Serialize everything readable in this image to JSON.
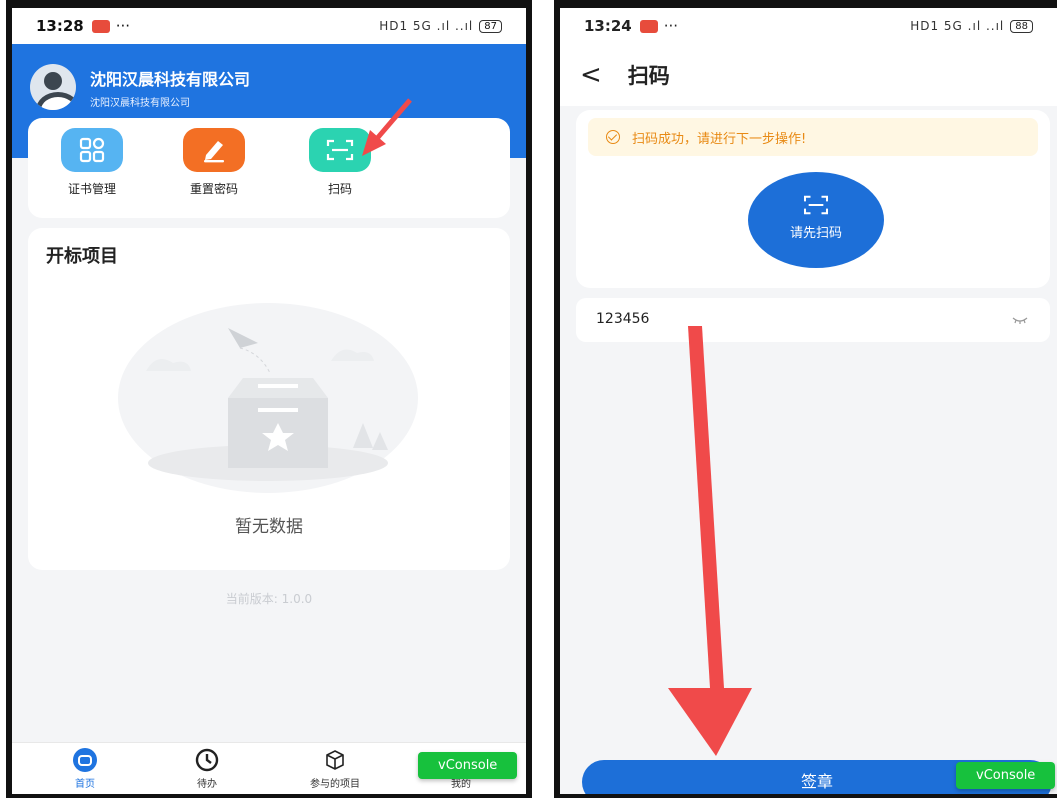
{
  "left_phone": {
    "status": {
      "time": "13:28",
      "indicators": "HD1 5G .ıl ..ıl",
      "battery": "87"
    },
    "company": {
      "name": "沈阳汉晨科技有限公司",
      "sub": "沈阳汉晨科技有限公司"
    },
    "quick_actions": [
      {
        "label": "证书管理",
        "icon": "grid-icon"
      },
      {
        "label": "重置密码",
        "icon": "edit-icon"
      },
      {
        "label": "扫码",
        "icon": "scan-icon"
      }
    ],
    "projects": {
      "title": "开标项目",
      "empty_text": "暂无数据"
    },
    "version": "当前版本: 1.0.0",
    "tabs": [
      {
        "label": "首页",
        "icon": "home-icon",
        "active": true
      },
      {
        "label": "待办",
        "icon": "clock-icon"
      },
      {
        "label": "参与的项目",
        "icon": "cube-icon"
      },
      {
        "label": "我的",
        "icon": "user-icon"
      }
    ],
    "vconsole": "vConsole"
  },
  "right_phone": {
    "status": {
      "time": "13:24",
      "indicators": "HD1 5G .ıl ..ıl",
      "battery": "88"
    },
    "nav": {
      "back": "<",
      "title": "扫码"
    },
    "banner": "扫码成功，请进行下一步操作!",
    "scan_button": "请先扫码",
    "input_value": "123456",
    "sign_button": "签章",
    "vconsole": "vConsole"
  },
  "colors": {
    "primary": "#1f74e0",
    "accent_arrow": "#f04a4a",
    "vconsole": "#17c13d",
    "banner_text": "#e88a14"
  }
}
